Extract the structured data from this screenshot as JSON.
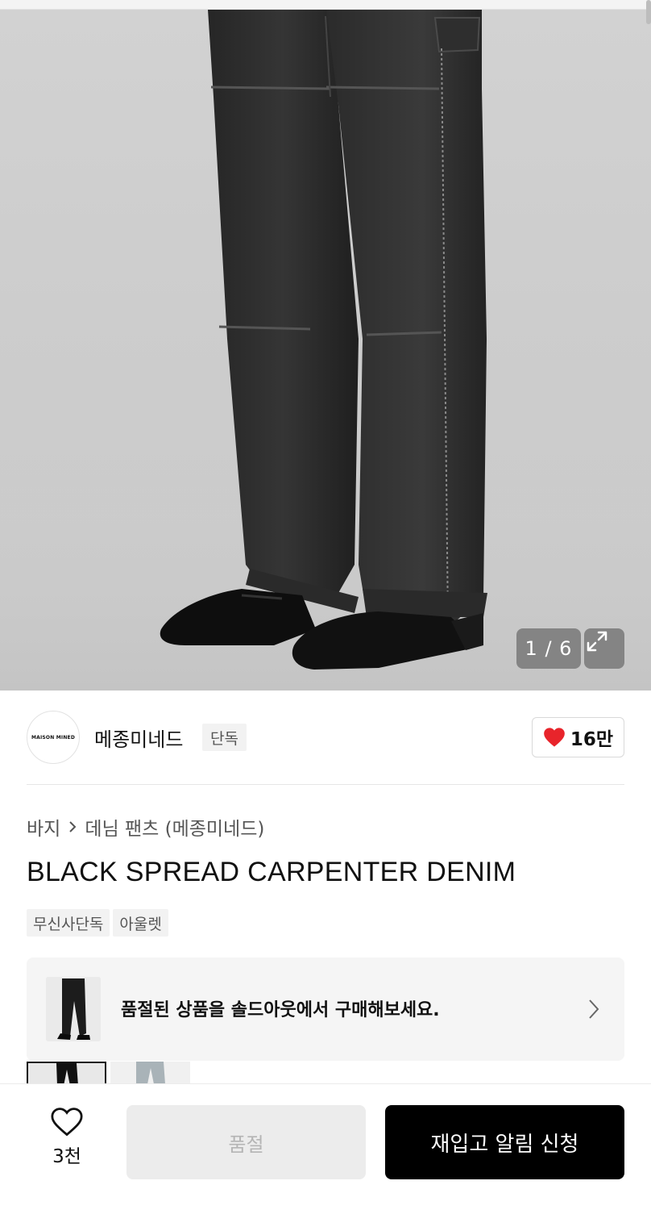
{
  "gallery": {
    "counter": "1 / 6",
    "icons": {
      "expand": "expand-diagonal-icon"
    }
  },
  "brand": {
    "logo_text": "MAISON MINED",
    "name": "메종미네드",
    "tag": "단독",
    "like_count": "16만",
    "like_color": "#e8242b"
  },
  "category": {
    "level1": "바지",
    "separator": ">",
    "level2": "데님 팬츠 (메종미네드)"
  },
  "product": {
    "title": "BLACK SPREAD CARPENTER DENIM",
    "tags": [
      "무신사단독",
      "아울렛"
    ]
  },
  "soldout_banner": {
    "text": "품절된 상품을 솔드아웃에서 구매해보세요."
  },
  "bottom_bar": {
    "wish_count": "3천",
    "soldout_label": "품절",
    "restock_label": "재입고 알림 신청"
  }
}
